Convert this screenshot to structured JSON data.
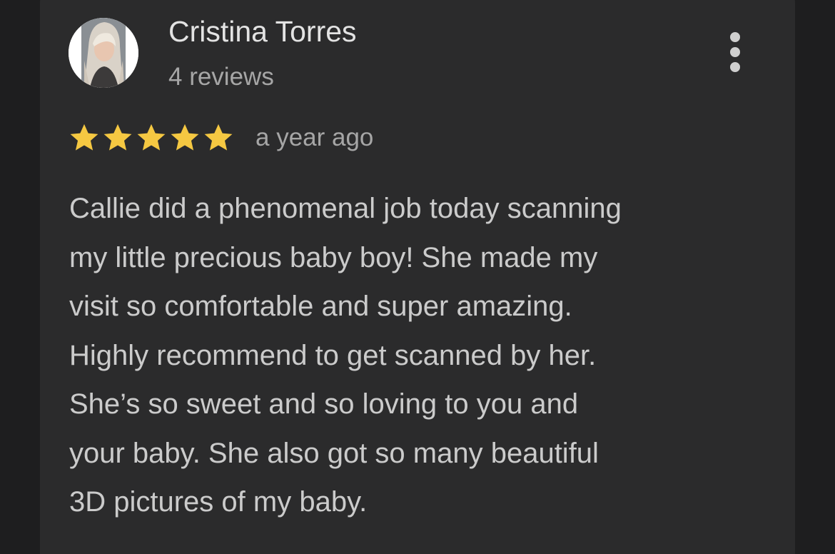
{
  "review": {
    "reviewer_name": "Cristina Torres",
    "review_count": "4 reviews",
    "rating": 5,
    "rating_max": 5,
    "date": "a year ago",
    "text_lines": [
      "Callie did a phenomenal job today scanning",
      "my little precious baby boy! She made my",
      "visit so comfortable and super amazing.",
      "Highly recommend to get scanned by her.",
      "She’s so sweet and so loving to you and",
      "your baby. She also got so many beautiful",
      "3D pictures of my baby."
    ]
  },
  "icons": {
    "more": "more-vert-icon",
    "star": "star-filled-icon",
    "avatar": "user-photo"
  },
  "colors": {
    "page_background": "#1e1e1f",
    "card_background": "#2b2b2c",
    "star": "#f5c842",
    "name_text": "#e3e3e3",
    "secondary_text": "#a6a6a6",
    "body_text": "#cbcbcb"
  }
}
